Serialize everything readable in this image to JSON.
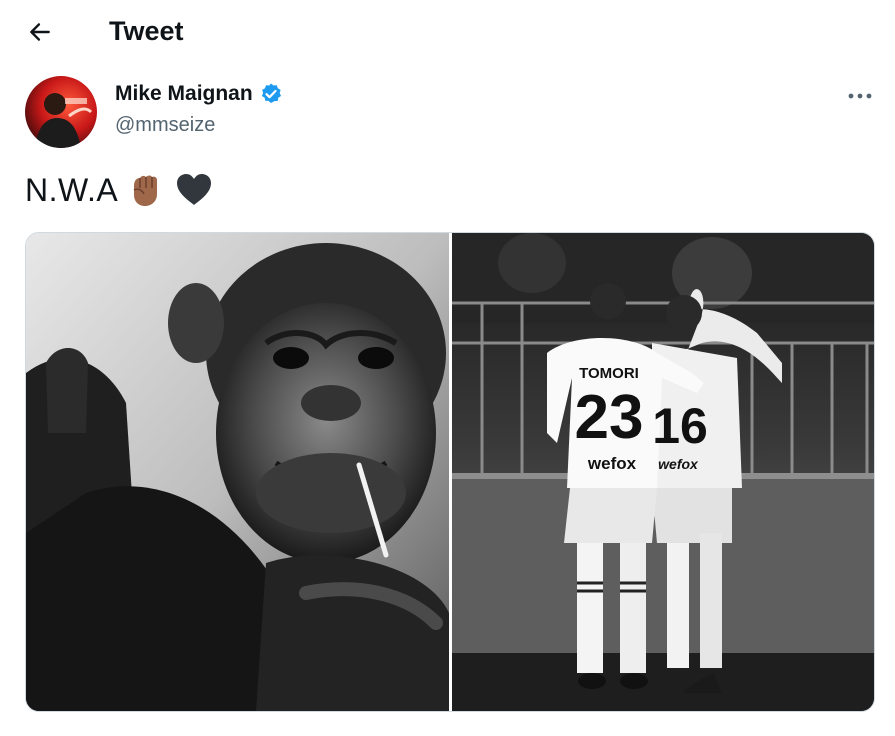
{
  "header": {
    "title": "Tweet",
    "back_icon": "arrow-left-icon"
  },
  "tweet": {
    "author_name": "Mike Maignan",
    "handle": "@mmseize",
    "verified": true,
    "verified_color": "#1d9bf0",
    "text": "N.W.A",
    "emojis": [
      "raised-fist-medium-dark-skin-emoji",
      "black-heart-emoji"
    ],
    "more_icon": "more-horizontal-icon"
  },
  "media": {
    "photo_left": "chimpanzee-photo",
    "photo_right": "football-players-photo",
    "jersey_left_name": "TOMORI",
    "jersey_left_number": "23",
    "jersey_right_number": "16",
    "sponsor": "wefox"
  }
}
